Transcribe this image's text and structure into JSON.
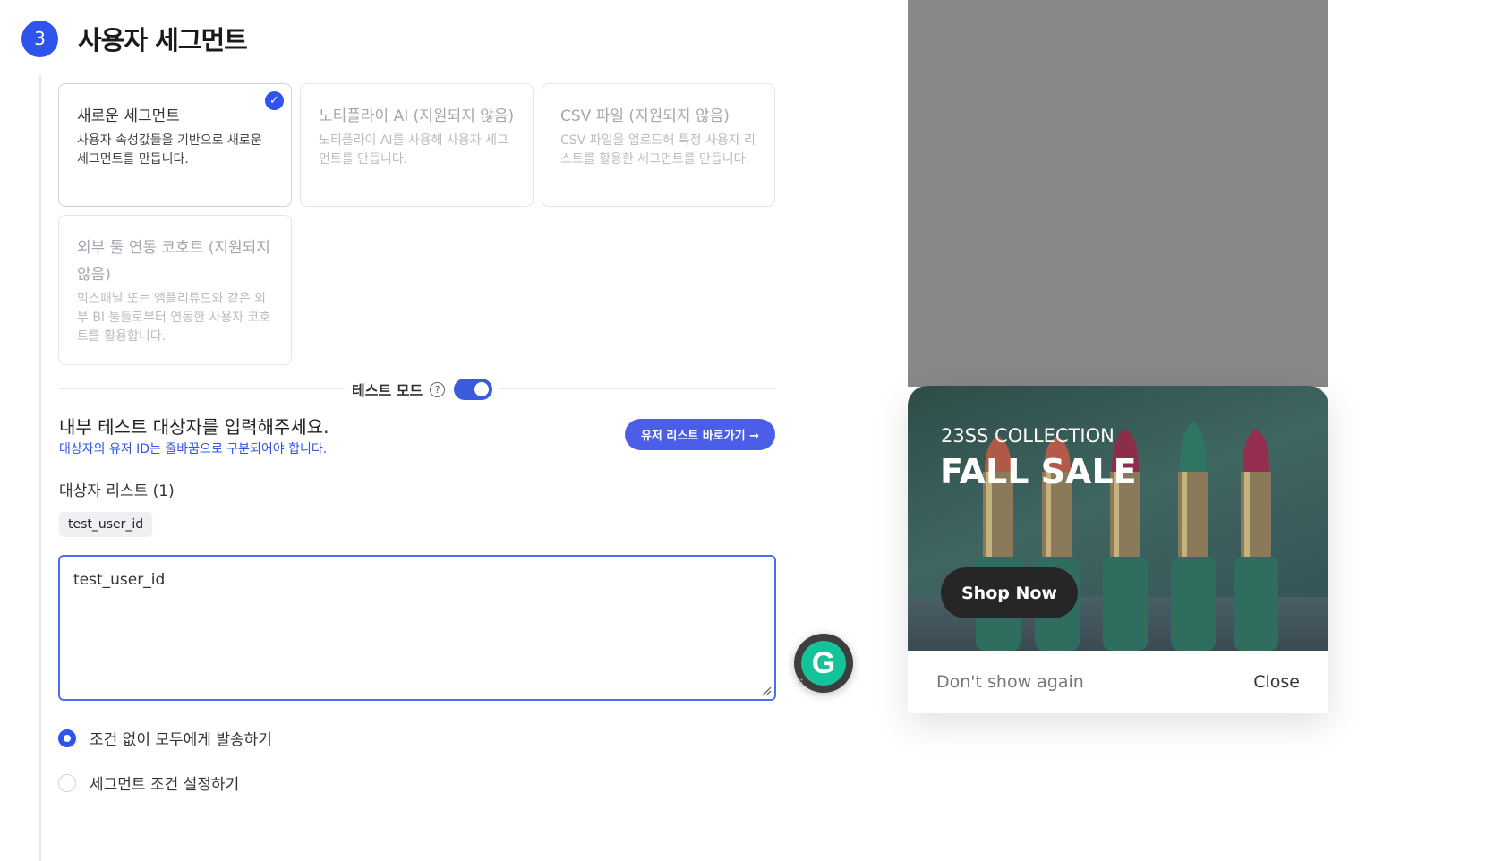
{
  "step": {
    "number": "3",
    "title": "사용자 세그먼트"
  },
  "cards": [
    {
      "title": "새로운 세그먼트",
      "desc": "사용자 속성값들을 기반으로 새로운 세그먼트를 만듭니다.",
      "selected": true,
      "enabled": true
    },
    {
      "title": "노티플라이 AI (지원되지 않음)",
      "desc": "노티플라이 AI를 사용해 사용자 세그먼트를 만듭니다.",
      "selected": false,
      "enabled": false
    },
    {
      "title": "CSV 파일 (지원되지 않음)",
      "desc": "CSV 파일을 업로드해 특정 사용자 리스트를 활용한 세그먼트를 만듭니다.",
      "selected": false,
      "enabled": false
    },
    {
      "title": "외부 툴 연동 코호트 (지원되지 않음)",
      "desc": "믹스패널 또는 앰플리튜드와 같은 외부 BI 툴들로부터 연동한 사용자 코호트를 활용합니다.",
      "selected": false,
      "enabled": false
    }
  ],
  "test_mode": {
    "label": "테스트 모드",
    "enabled": true
  },
  "test_targets": {
    "prompt": "내부 테스트 대상자를 입력해주세요.",
    "hint": "대상자의 유저 ID는 줄바꿈으로 구분되어야 합니다.",
    "user_list_button": "유저 리스트 바로가기 →",
    "list_heading": "대상자 리스트 (1)",
    "chips": [
      "test_user_id"
    ],
    "textarea_value": "test_user_id"
  },
  "send_options": [
    {
      "label": "조건 없이 모두에게 발송하기",
      "checked": true
    },
    {
      "label": "세그먼트 조건 설정하기",
      "checked": false
    }
  ],
  "grammarly": {
    "letter": "G"
  },
  "preview": {
    "banner_sub": "23SS COLLECTION",
    "banner_title": "FALL SALE",
    "cta": "Shop Now",
    "dont_show": "Don't show again",
    "close": "Close"
  },
  "colors": {
    "accent": "#2f54eb",
    "toggle": "#3b5bdb",
    "button": "#4c5ee8",
    "grammarly": "#15c39a",
    "backdrop": "#888888"
  }
}
